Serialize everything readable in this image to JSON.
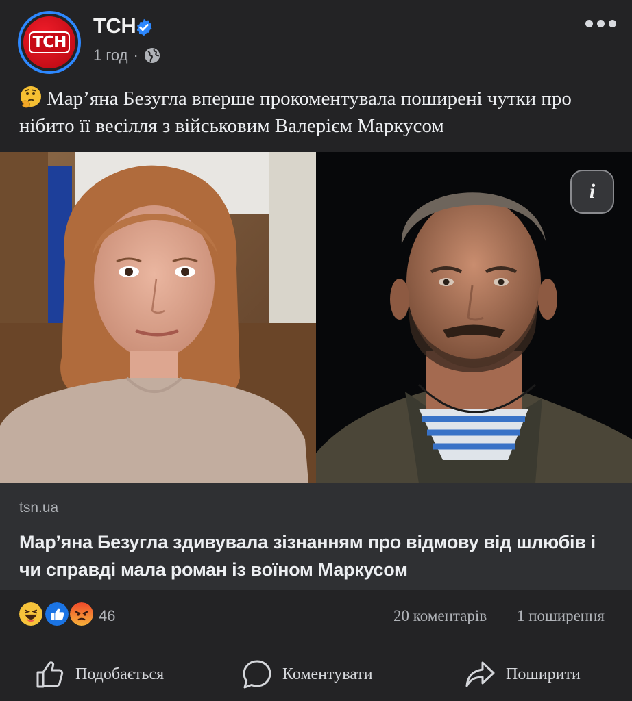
{
  "post": {
    "page_name": "ТСН",
    "avatar_text": "ТСН",
    "time": "1 год",
    "separator": "·",
    "caption": "Мар’яна Безугла вперше прокоментувала поширені чутки про нібито її весілля з військовим Валерієм Маркусом",
    "info_label": "i"
  },
  "link": {
    "domain": "tsn.ua",
    "title": "Мар’яна Безугла здивувала зізнанням про відмову від шлюбів і чи справді мала роман із воїном Маркусом"
  },
  "stats": {
    "reaction_count": "46",
    "comments": "20 коментарів",
    "shares": "1 поширення",
    "reactions": [
      "haha-icon",
      "like-icon",
      "angry-icon"
    ]
  },
  "actions": {
    "like": "Подобається",
    "comment": "Коментувати",
    "share": "Поширити"
  },
  "colors": {
    "background": "#232325",
    "link_box": "#2f3033",
    "verified": "#2d88ff",
    "brand_red": "#c70a16"
  }
}
